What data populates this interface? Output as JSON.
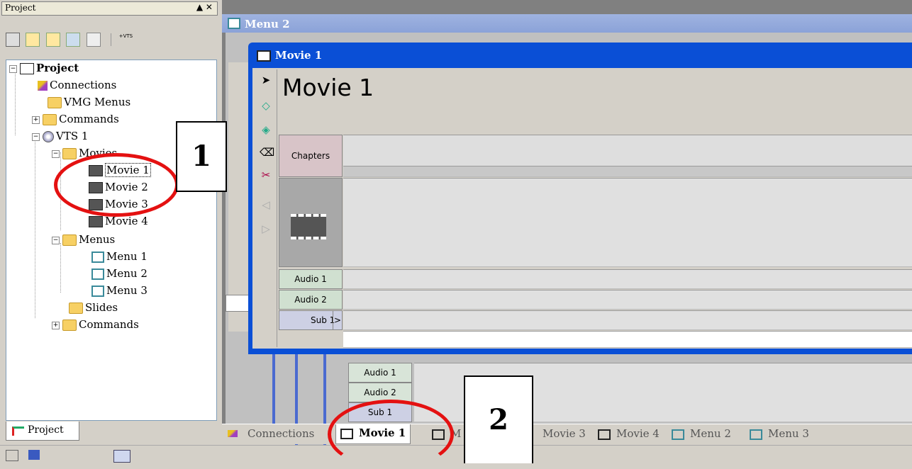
{
  "project_panel": {
    "title": "Project",
    "title_buttons": "▲ ✕",
    "toolbar_icons": [
      "new-movie-icon",
      "new-menu-icon",
      "new-slides-icon",
      "new-image-icon",
      "new-audio-icon",
      "add-vts-icon"
    ],
    "toolbar_vts": "+VTS",
    "tree": {
      "root": "Project",
      "connections": "Connections",
      "vmg_menus": "VMG Menus",
      "commands": "Commands",
      "vts": "VTS 1",
      "movies": "Movies",
      "movie_items": [
        "Movie 1",
        "Movie 2",
        "Movie 3",
        "Movie 4"
      ],
      "menus": "Menus",
      "menu_items": [
        "Menu 1",
        "Menu 2",
        "Menu 3"
      ],
      "slides": "Slides",
      "commands2": "Commands"
    },
    "bottom_tab": "Project"
  },
  "menu2_window": {
    "title": "Menu 2",
    "row_labels": [
      "Audio 1",
      "Audio 2",
      "Sub 1"
    ]
  },
  "movie_window": {
    "title": "Movie 1",
    "heading": "Movie 1",
    "rows": {
      "chapters": "Chapters",
      "audio1": "Audio 1",
      "audio2": "Audio 2",
      "sub1": "Sub 1",
      "expand": ">"
    }
  },
  "tabs": [
    "Connections",
    "Movie 1",
    "M",
    "Movie 3",
    "Movie 4",
    "Menu 2",
    "Menu 3"
  ],
  "callouts": [
    "1",
    "2"
  ],
  "colors": {
    "callout_ring": "#e41111",
    "title_active": "#0a4fd6",
    "title_inactive": "#9fb3e0"
  }
}
